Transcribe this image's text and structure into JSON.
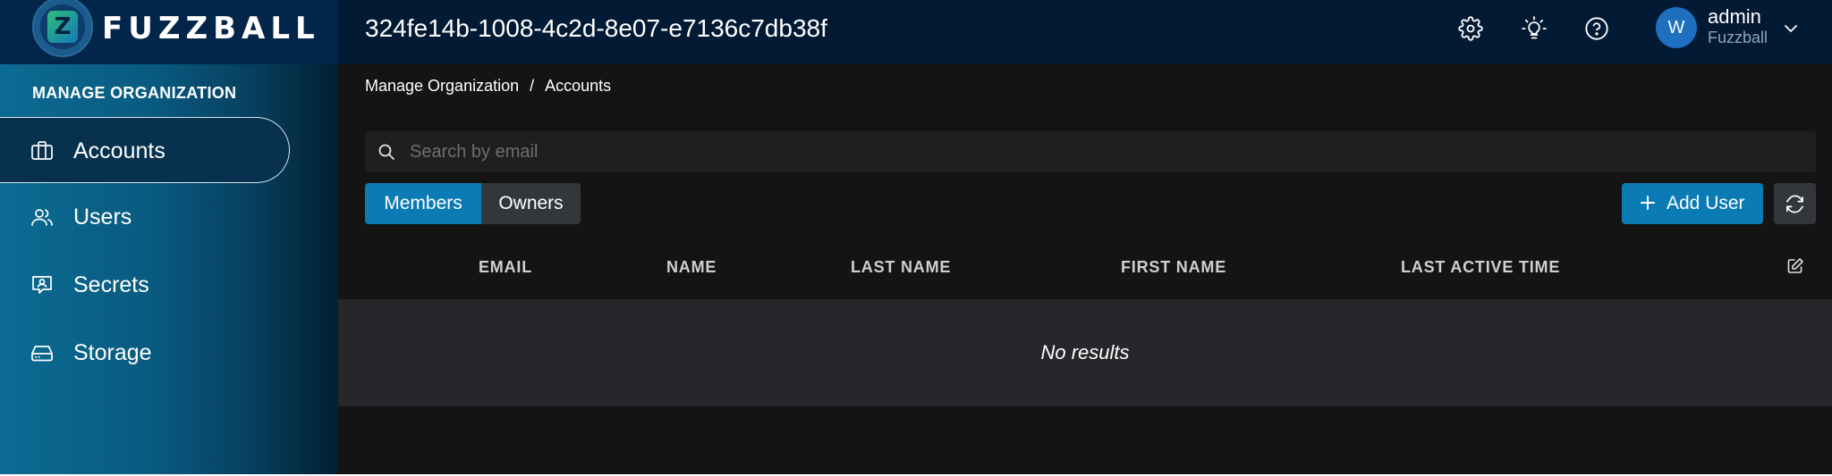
{
  "brand": {
    "name": "FUZZBALL",
    "logo_letter": "Z"
  },
  "header": {
    "org_id": "324fe14b-1008-4c2d-8e07-e7136c7db38f",
    "icons": [
      "gear-icon",
      "lightbulb-icon",
      "help-icon"
    ],
    "user": {
      "initial": "W",
      "name": "admin",
      "org": "Fuzzball"
    }
  },
  "sidebar": {
    "title": "MANAGE ORGANIZATION",
    "items": [
      {
        "label": "Accounts",
        "icon": "briefcase-icon",
        "active": true
      },
      {
        "label": "Users",
        "icon": "users-icon",
        "active": false
      },
      {
        "label": "Secrets",
        "icon": "secret-badge-icon",
        "active": false
      },
      {
        "label": "Storage",
        "icon": "storage-drive-icon",
        "active": false
      }
    ]
  },
  "main": {
    "breadcrumb": [
      "Manage Organization",
      "Accounts"
    ],
    "breadcrumb_sep": "/",
    "search": {
      "placeholder": "Search by email",
      "value": ""
    },
    "tabs": [
      {
        "label": "Members",
        "selected": true
      },
      {
        "label": "Owners",
        "selected": false
      }
    ],
    "add_user_label": "Add User",
    "table": {
      "columns": [
        "EMAIL",
        "NAME",
        "LAST NAME",
        "FIRST NAME",
        "LAST ACTIVE TIME"
      ],
      "empty_message": "No results"
    }
  },
  "colors": {
    "accent": "#0b7bb5",
    "topbar": "#021a33",
    "sidebar_start": "#0c6b93",
    "avatar": "#1f6fc1"
  }
}
